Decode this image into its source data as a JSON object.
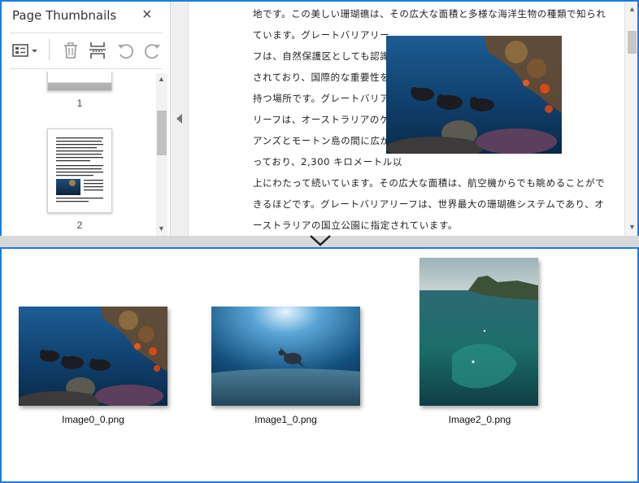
{
  "thumbnails_panel": {
    "title": "Page Thumbnails",
    "close_icon": "×",
    "toolbar_icons": [
      "page-options-icon",
      "trash-icon",
      "insert-page-icon",
      "rotate-left-icon",
      "rotate-right-icon"
    ],
    "pages": [
      {
        "label": "1"
      },
      {
        "label": "2"
      }
    ]
  },
  "document": {
    "lines": [
      "地です。この美しい珊瑚礁は、その広大な面積と多様な海洋生物の種類で知られ",
      "ています。グレートバリアリー",
      "フは、自然保護区としても認識",
      "されており、国際的な重要性を",
      "持つ場所です。グレートバリア",
      "リーフは、オーストラリアのケ",
      "アンズとモートン島の間に広が",
      "っており、2,300 キロメートル以",
      "上にわたって続いています。その広大な面積は、航空機からでも眺めることがで",
      "きるほどです。グレートバリアリーフは、世界最大の珊瑚礁システムであり、オ",
      "ーストラリアの国立公園に指定されています。"
    ]
  },
  "extracted_images": [
    {
      "name": "Image0_0.png"
    },
    {
      "name": "Image1_0.png"
    },
    {
      "name": "Image2_0.png"
    }
  ],
  "colors": {
    "accent_border": "#1e7be0",
    "splitter": "#d8d8d8"
  }
}
